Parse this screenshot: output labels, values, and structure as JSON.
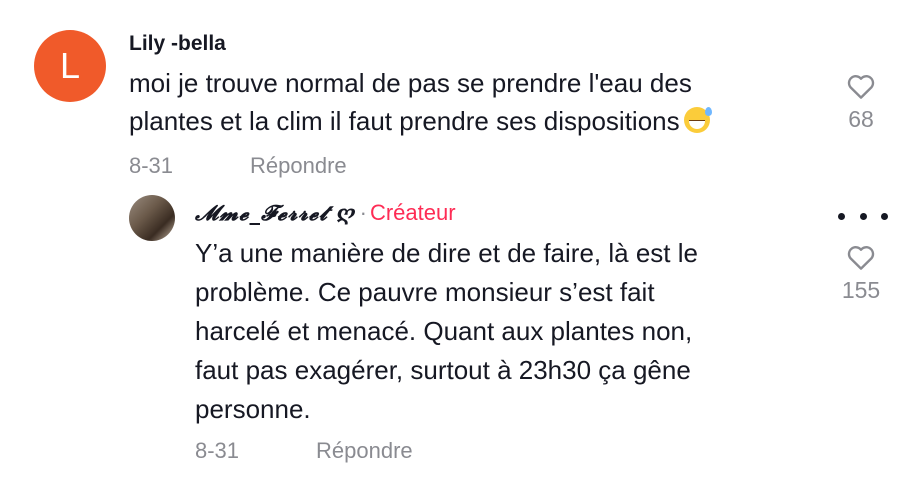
{
  "comment": {
    "avatar_letter": "L",
    "avatar_color": "#f05a2a",
    "username": "Lily -bella",
    "text_lines": [
      "moi je trouve normal de pas se prendre l'eau des",
      "plantes et la clim il faut prendre ses dispositions"
    ],
    "emoji": "grinning-face-with-sweat",
    "date": "8-31",
    "reply_label": "Répondre",
    "like_count": "68"
  },
  "reply": {
    "username": "𝓜𝓶𝓮_𝓕𝓮𝓻𝓻𝓮𝓽 ღ",
    "separator": "·",
    "badge": "Créateur",
    "badge_color": "#fe2c55",
    "text_lines": [
      "Y’a une manière de dire et de faire, là est le",
      "problème. Ce pauvre monsieur s’est fait",
      "harcelé et menacé. Quant aux plantes non,",
      "faut pas exagérer, surtout à 23h30 ça gêne",
      "personne."
    ],
    "date": "8-31",
    "reply_label": "Répondre",
    "like_count": "155"
  },
  "icons": {
    "like": "heart-outline-icon",
    "more": "more-options-icon"
  }
}
